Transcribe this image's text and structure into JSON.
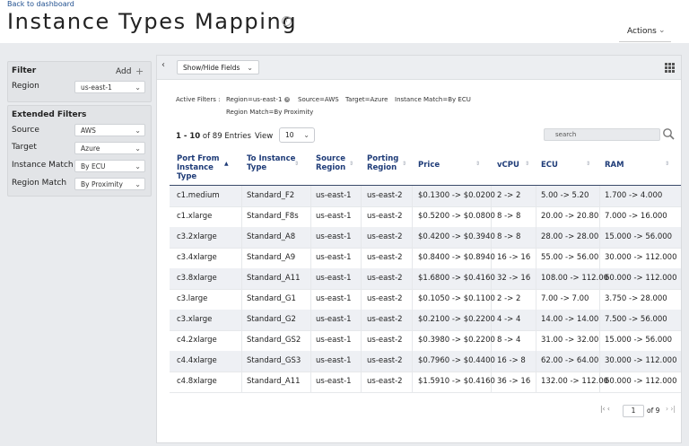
{
  "header": {
    "back_link": "Back to dashboard",
    "title": "Instance Types Mapping",
    "actions_label": "Actions"
  },
  "filter": {
    "title": "Filter",
    "add_label": "Add",
    "region_label": "Region",
    "region_value": "us-east-1"
  },
  "extended": {
    "title": "Extended Filters",
    "fields": [
      {
        "label": "Source",
        "value": "AWS"
      },
      {
        "label": "Target",
        "value": "Azure"
      },
      {
        "label": "Instance Match",
        "value": "By ECU"
      },
      {
        "label": "Region Match",
        "value": "By Proximity"
      }
    ]
  },
  "toolbar": {
    "show_hide_label": "Show/Hide Fields"
  },
  "active_filters": {
    "label": "Active Filters :",
    "chips": [
      "Region=us-east-1",
      "Source=AWS",
      "Target=Azure",
      "Instance Match=By ECU",
      "Region Match=By Proximity"
    ]
  },
  "entries": {
    "range": "1 - 10",
    "of_text": "of 89 Entries",
    "view_label": "View",
    "view_value": "10",
    "search_placeholder": "search"
  },
  "table": {
    "columns": [
      {
        "label": "Port From Instance Type"
      },
      {
        "label": "To Instance Type"
      },
      {
        "label": "Source Region"
      },
      {
        "label": "Porting Region"
      },
      {
        "label": "Price"
      },
      {
        "label": "vCPU"
      },
      {
        "label": "ECU"
      },
      {
        "label": "RAM"
      }
    ],
    "rows": [
      [
        "c1.medium",
        "Standard_F2",
        "us-east-1",
        "us-east-2",
        "$0.1300 -> $0.0200",
        "2 -> 2",
        "5.00 -> 5.20",
        "1.700 -> 4.000"
      ],
      [
        "c1.xlarge",
        "Standard_F8s",
        "us-east-1",
        "us-east-2",
        "$0.5200 -> $0.0800",
        "8 -> 8",
        "20.00 -> 20.80",
        "7.000 -> 16.000"
      ],
      [
        "c3.2xlarge",
        "Standard_A8",
        "us-east-1",
        "us-east-2",
        "$0.4200 -> $0.3940",
        "8 -> 8",
        "28.00 -> 28.00",
        "15.000 -> 56.000"
      ],
      [
        "c3.4xlarge",
        "Standard_A9",
        "us-east-1",
        "us-east-2",
        "$0.8400 -> $0.8940",
        "16 -> 16",
        "55.00 -> 56.00",
        "30.000 -> 112.000"
      ],
      [
        "c3.8xlarge",
        "Standard_A11",
        "us-east-1",
        "us-east-2",
        "$1.6800 -> $0.4160",
        "32 -> 16",
        "108.00 -> 112.00",
        "60.000 -> 112.000"
      ],
      [
        "c3.large",
        "Standard_G1",
        "us-east-1",
        "us-east-2",
        "$0.1050 -> $0.1100",
        "2 -> 2",
        "7.00 -> 7.00",
        "3.750 -> 28.000"
      ],
      [
        "c3.xlarge",
        "Standard_G2",
        "us-east-1",
        "us-east-2",
        "$0.2100 -> $0.2200",
        "4 -> 4",
        "14.00 -> 14.00",
        "7.500 -> 56.000"
      ],
      [
        "c4.2xlarge",
        "Standard_GS2",
        "us-east-1",
        "us-east-2",
        "$0.3980 -> $0.2200",
        "8 -> 4",
        "31.00 -> 32.00",
        "15.000 -> 56.000"
      ],
      [
        "c4.4xlarge",
        "Standard_GS3",
        "us-east-1",
        "us-east-2",
        "$0.7960 -> $0.4400",
        "16 -> 8",
        "62.00 -> 64.00",
        "30.000 -> 112.000"
      ],
      [
        "c4.8xlarge",
        "Standard_A11",
        "us-east-1",
        "us-east-2",
        "$1.5910 -> $0.4160",
        "36 -> 16",
        "132.00 -> 112.00",
        "60.000 -> 112.000"
      ]
    ]
  },
  "pager": {
    "current": "1",
    "total_text": "of 9"
  }
}
